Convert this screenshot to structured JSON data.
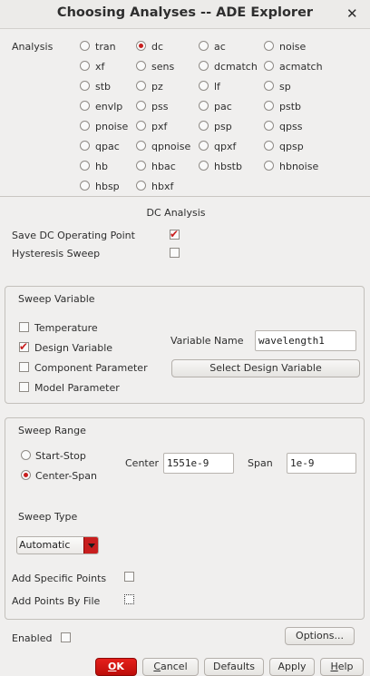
{
  "window": {
    "title": "Choosing Analyses -- ADE Explorer"
  },
  "analysis": {
    "label": "Analysis",
    "selected": "dc",
    "options": [
      "tran",
      "dc",
      "ac",
      "noise",
      "xf",
      "sens",
      "dcmatch",
      "acmatch",
      "stb",
      "pz",
      "lf",
      "sp",
      "envlp",
      "pss",
      "pac",
      "pstb",
      "pnoise",
      "pxf",
      "psp",
      "qpss",
      "qpac",
      "qpnoise",
      "qpxf",
      "qpsp",
      "hb",
      "hbac",
      "hbstb",
      "hbnoise",
      "hbsp",
      "hbxf"
    ]
  },
  "dc": {
    "section_title": "DC Analysis",
    "save_op_label": "Save DC Operating Point",
    "save_op_checked": true,
    "hysteresis_label": "Hysteresis Sweep",
    "hysteresis_checked": false
  },
  "sweep_variable": {
    "title": "Sweep Variable",
    "options": [
      {
        "label": "Temperature",
        "checked": false
      },
      {
        "label": "Design Variable",
        "checked": true
      },
      {
        "label": "Component Parameter",
        "checked": false
      },
      {
        "label": "Model Parameter",
        "checked": false
      }
    ],
    "variable_name_label": "Variable Name",
    "variable_name_value": "wavelength1",
    "select_button": "Select Design Variable"
  },
  "sweep_range": {
    "title": "Sweep Range",
    "start_stop_label": "Start-Stop",
    "center_span_label": "Center-Span",
    "selected": "Center-Span",
    "center_label": "Center",
    "center_value": "1551e-9",
    "span_label": "Span",
    "span_value": "1e-9",
    "sweep_type_label": "Sweep Type",
    "sweep_type_value": "Automatic",
    "add_specific_label": "Add Specific Points",
    "add_specific_checked": false,
    "add_by_file_label": "Add Points By File",
    "add_by_file_checked": false
  },
  "enabled": {
    "label": "Enabled",
    "checked": false
  },
  "buttons": {
    "options": "Options...",
    "ok_u": "O",
    "ok_rest": "K",
    "cancel_u": "C",
    "cancel_rest": "ancel",
    "defaults": "Defaults",
    "apply": "Apply",
    "help_u": "H",
    "help_rest": "elp"
  },
  "colors": {
    "accent": "#c81e1e",
    "background": "#f0efee"
  }
}
